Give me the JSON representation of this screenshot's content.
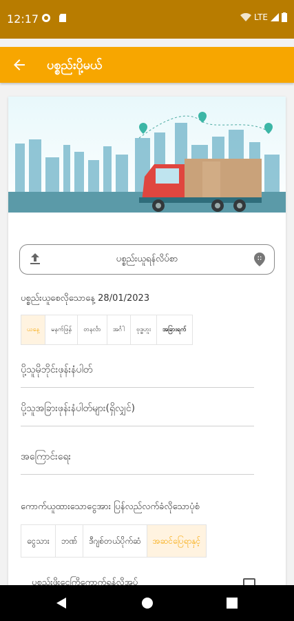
{
  "status_bar": {
    "time": "12:17",
    "network": "LTE"
  },
  "app_bar": {
    "title": "ပစ္စည်းပို့မယ်",
    "back_icon": "arrow-left-icon"
  },
  "colors": {
    "accent": "#f7a600",
    "status_bar": "#b87c00",
    "active_bg": "#fff3e0"
  },
  "form": {
    "pickup_button_label": "ပစ္စည်းယူရန်လိပ်စာ",
    "pickup_date_label": "ပစ္စည်းယူစေလိုသောနေ့ 28/01/2023",
    "date_options": [
      "ယနေ့",
      "မနက်ဖြန်",
      "တနင်္လာ",
      "အင်္ဂါ",
      "ဗုဒ္ဓဟူး",
      "အခြားရက်"
    ],
    "date_selected": "ယနေ့",
    "receiver_phone_placeholder": "ပို့သူမိုဘိုင်းဖုန်းနံပါတ်",
    "other_phone_placeholder": "ပို့သူအခြားဖုန်းနံပါတ်များ(ရှိလျှင်)",
    "note_placeholder": "အကြောင်းရေး",
    "payment_question": "ကောက်ယူထားသောငွေအား ပြန်လည်လက်ခံလိုသောပုံစံ",
    "payment_options": [
      "ငွေသား",
      "ဘဏ်",
      "ဒီဂျစ်တယ်ပိုက်ဆံ",
      "အဆင်ပြေရာနှင့်"
    ],
    "payment_selected": "အဆင်ပြေရာနှင့်",
    "cut_row_label": "ပစ္စည်းဖိုးငွေကြိုကောက်ရန်လိုအပ်"
  }
}
